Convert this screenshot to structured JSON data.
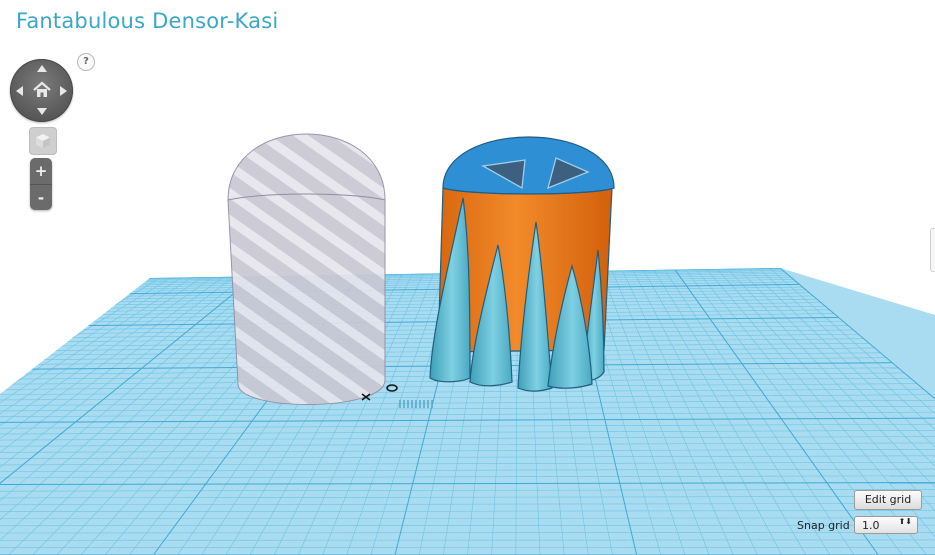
{
  "app": {
    "design_title": "Fantabulous Densor-Kasi"
  },
  "help": {
    "label": "?"
  },
  "navigation": {
    "icons": [
      "arrow-up-icon",
      "arrow-down-icon",
      "arrow-left-icon",
      "arrow-right-icon",
      "home-icon"
    ]
  },
  "view": {
    "cube_icon": "view-cube-icon"
  },
  "zoom": {
    "in_label": "+",
    "out_label": "-"
  },
  "grid": {
    "edit_label": "Edit grid",
    "snap_label": "Snap grid",
    "snap_value": "1.0",
    "snap_arrows": "⬆⬇"
  },
  "scene": {
    "objects": [
      "hole-cylinder",
      "tentacle-creature"
    ],
    "colors": {
      "grid": "#a9dcf0",
      "grid_line": "#58b9df",
      "hole": "#c9c8d3",
      "body": "#f07d1f",
      "cap": "#2e8fd4",
      "tentacle": "#6cc3d8"
    }
  }
}
